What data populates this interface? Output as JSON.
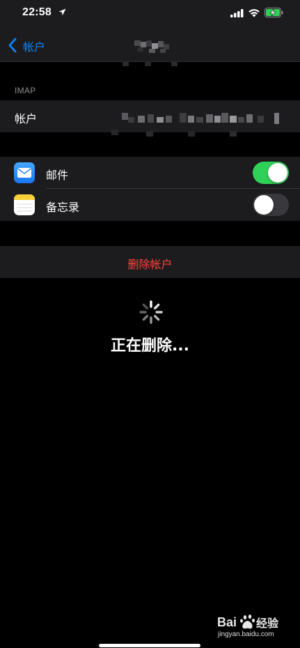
{
  "status_bar": {
    "time": "22:58",
    "icons": [
      "location-arrow-icon",
      "cellular-signal-icon",
      "wifi-icon",
      "battery-charging-icon"
    ],
    "battery_color": "#30d158"
  },
  "nav": {
    "back_label": "帐户",
    "title_obscured": true
  },
  "section": {
    "header": "IMAP"
  },
  "account_row": {
    "label": "帐户",
    "value_obscured": true
  },
  "apps": [
    {
      "label": "邮件",
      "icon": "mail-icon",
      "enabled": true
    },
    {
      "label": "备忘录",
      "icon": "notes-icon",
      "enabled": false
    }
  ],
  "delete_button": {
    "label": "删除帐户",
    "color": "#ff453a"
  },
  "progress": {
    "label": "正在删除..."
  },
  "watermark": {
    "text": "Bai 经验",
    "url": "jingyan.baidu.com"
  },
  "colors": {
    "accent": "#0a84ff",
    "toggle_on": "#30d158",
    "toggle_off": "#39393d",
    "cell_background": "#1c1c1e"
  }
}
